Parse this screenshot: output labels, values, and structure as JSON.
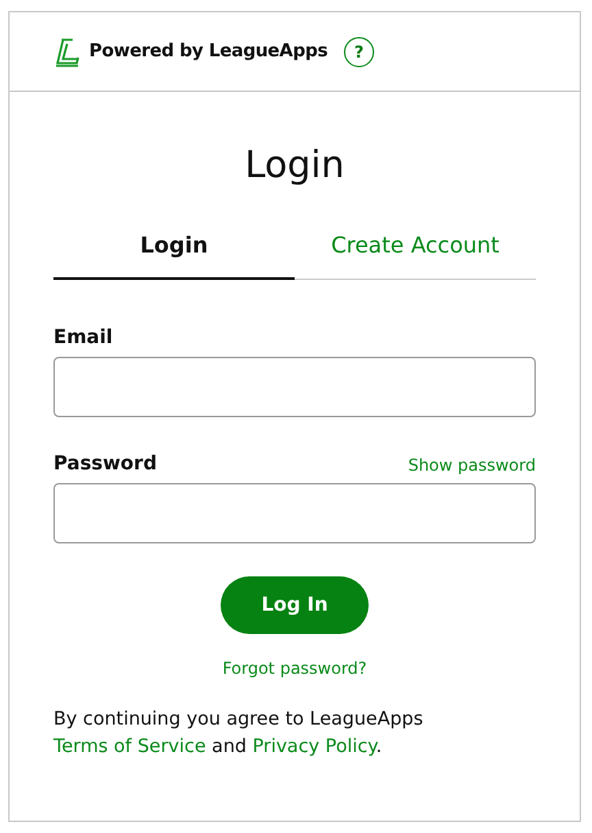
{
  "header": {
    "brand": "Powered by LeagueApps",
    "help": "?"
  },
  "title": "Login",
  "tabs": [
    {
      "label": "Login",
      "selected": true
    },
    {
      "label": "Create Account",
      "selected": false
    }
  ],
  "form": {
    "email_label": "Email",
    "password_label": "Password",
    "show_password": "Show password",
    "submit": "Log In",
    "forgot": "Forgot password?"
  },
  "terms": [
    {
      "kind": "text",
      "text": "By continuing you agree to LeagueApps "
    },
    {
      "kind": "link",
      "text": "Terms of Service"
    },
    {
      "kind": "text",
      "text": " and "
    },
    {
      "kind": "link",
      "text": "Privacy Policy"
    },
    {
      "kind": "text",
      "text": "."
    }
  ]
}
